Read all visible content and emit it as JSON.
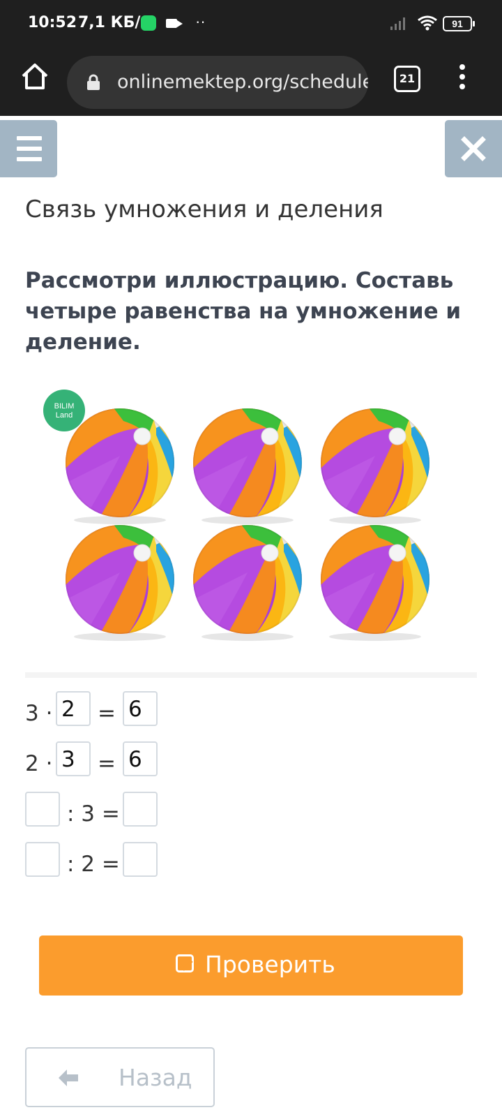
{
  "status_bar": {
    "time": "10:52",
    "speed": "7,1 КБ/с",
    "dots": "··",
    "battery": "91"
  },
  "browser": {
    "url": "onlinemektep.org/schedule",
    "tab_count": "21"
  },
  "page": {
    "title": "Связь умножения и деления",
    "instruction": "Рассмотри иллюстрацию. Составь четыре равенства на умножение и деление."
  },
  "illustration": {
    "logo_text": [
      "BILIM",
      "Land"
    ],
    "ball_count": 6,
    "rows": 2,
    "cols": 3
  },
  "equations": [
    {
      "pre": "3 ·",
      "box1": "2",
      "mid": "=",
      "box2": "6"
    },
    {
      "pre": "2 ·",
      "box1": "3",
      "mid": "=",
      "box2": "6"
    },
    {
      "box1": "",
      "mid": ": 3 =",
      "box2": ""
    },
    {
      "box1": "",
      "mid": ": 2 =",
      "box2": ""
    }
  ],
  "buttons": {
    "check": "Проверить",
    "back": "Назад"
  },
  "colors": {
    "accent_orange": "#fb9c2d",
    "side_button": "#a2b5c4",
    "logo_green": "#35b277"
  }
}
